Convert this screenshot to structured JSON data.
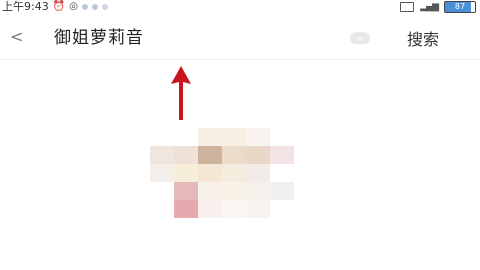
{
  "status_bar": {
    "time": "上午9:43",
    "battery_label": "87",
    "battery_level": 0.87,
    "icons": [
      "alarm-icon",
      "notification-icon",
      "sim-icon",
      "signal-icon",
      "battery-icon"
    ]
  },
  "search_bar": {
    "back_label": "<",
    "query": "御姐萝莉音",
    "clear_label": "×",
    "submit_label": "搜索"
  },
  "colors": {
    "arrow": "#c8141e",
    "accent": "#4a90d9"
  }
}
